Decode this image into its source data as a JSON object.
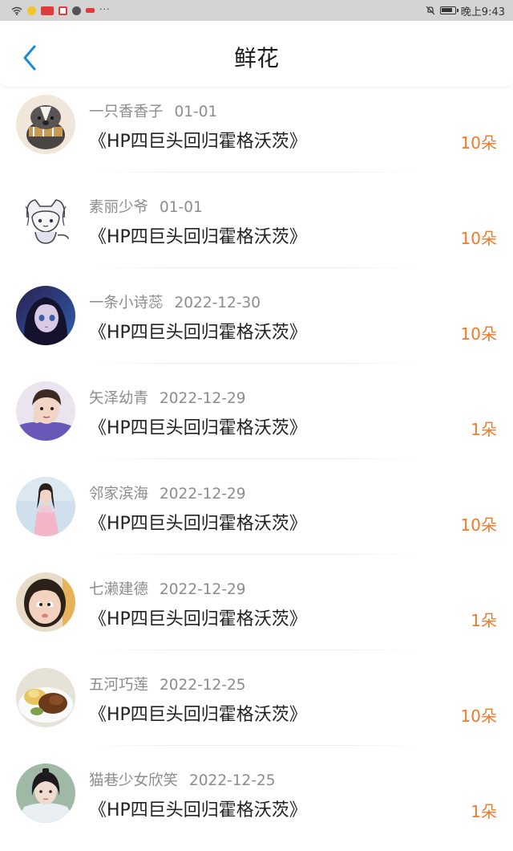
{
  "status_bar": {
    "time": "晚上9:43",
    "icons": [
      "wifi-icon",
      "app-icon",
      "app-icon",
      "app-icon",
      "wechat-icon",
      "app-icon",
      "more-icon",
      "mute-icon",
      "battery-icon"
    ]
  },
  "header": {
    "title": "鲜花",
    "back_icon": "chevron-left-icon",
    "accent_color": "#1a8cdc"
  },
  "colors": {
    "count": "#f07a2a",
    "meta": "#8c8c8c",
    "title": "#222222"
  },
  "items": [
    {
      "user": "一只香香子",
      "date": "01-01",
      "book": "《HP四巨头回归霍格沃茨》",
      "count": "10朵",
      "avatar": "badger-cartoon"
    },
    {
      "user": "素丽少爷",
      "date": "01-01",
      "book": "《HP四巨头回归霍格沃茨》",
      "count": "10朵",
      "avatar": "cat-sketch"
    },
    {
      "user": "一条小诗蕊",
      "date": "2022-12-30",
      "book": "《HP四巨头回归霍格沃茨》",
      "count": "10朵",
      "avatar": "anime-girl"
    },
    {
      "user": "矢泽幼青",
      "date": "2022-12-29",
      "book": "《HP四巨头回归霍格沃茨》",
      "count": "1朵",
      "avatar": "person-photo"
    },
    {
      "user": "邻家滨海",
      "date": "2022-12-29",
      "book": "《HP四巨头回归霍格沃茨》",
      "count": "10朵",
      "avatar": "woman-pink-dress"
    },
    {
      "user": "七濑建德",
      "date": "2022-12-29",
      "book": "《HP四巨头回归霍格沃茨》",
      "count": "1朵",
      "avatar": "child-face"
    },
    {
      "user": "五河巧莲",
      "date": "2022-12-25",
      "book": "《HP四巨头回归霍格沃茨》",
      "count": "10朵",
      "avatar": "food-plate"
    },
    {
      "user": "猫巷少女欣笑",
      "date": "2022-12-25",
      "book": "《HP四巨头回归霍格沃茨》",
      "count": "1朵",
      "avatar": "costume-portrait"
    }
  ]
}
